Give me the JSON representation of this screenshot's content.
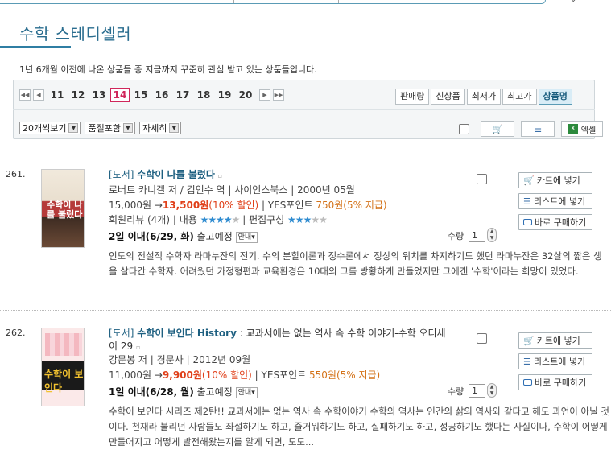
{
  "page": {
    "title": "수학 스테디셀러",
    "description": "1년 6개월 이전에 나온 상품들 중 지금까지 꾸준히 관심 받고 있는 상품들입니다."
  },
  "pagination": {
    "pages": [
      "11",
      "12",
      "13",
      "14",
      "15",
      "16",
      "17",
      "18",
      "19",
      "20"
    ],
    "current": "14",
    "first_icon": "first-page-icon",
    "prev_icon": "prev-page-icon",
    "next_icon": "next-page-icon",
    "last_icon": "last-page-icon"
  },
  "sort": {
    "tabs": [
      "판매량",
      "신상품",
      "최저가",
      "최고가",
      "상품명"
    ],
    "active": "상품명"
  },
  "filters": {
    "per_page": "20개씩보기",
    "stock": "품절포함",
    "view": "자세히"
  },
  "toolbar": {
    "excel_label": "엑셀",
    "cart_icon": "cart-icon",
    "list_icon": "list-icon",
    "excel_icon": "excel-icon"
  },
  "actions": {
    "cart": "카트에 넣기",
    "wishlist": "리스트에 넣기",
    "buy_now": "바로 구매하기"
  },
  "labels": {
    "quantity": "수량",
    "guide": "안내",
    "arrow": "→"
  },
  "items": [
    {
      "index": "261.",
      "category": "[도서]",
      "title": "수학이 나를 불렀다",
      "subtitle": "",
      "subtitle_cont": "",
      "meta": "로버트 카니겔 저 / 김인수 역 | 사이언스북스 | 2000년 05월",
      "list_price": "15,000원",
      "sale_price": "13,500원",
      "discount": "(10% 할인)",
      "points_label": " | YES포인트 ",
      "points": "750원(5% 지급)",
      "review_label": "회원리뷰 (4개)",
      "content_label": " | 내용 ",
      "content_stars": 4,
      "edit_label": " | 편집구성 ",
      "edit_stars": 3,
      "shipping_bold": "2일 이내(6/29, 화)",
      "shipping_text": " 출고예정",
      "quantity": "1",
      "cover_text": "수학이 나를 불렀다",
      "description": "인도의 전설적 수학자 라마누잔의 전기. 수의 분할이론과 정수론에서 정상의 위치를 차지하기도 했던 라마누잔은 32살의 짧은 생을 살다간 수학자. 어려웠던 가정형편과 교육환경은 10대의 그를 방황하게 만들었지만 그에겐 '수학'이라는 희망이 있었다."
    },
    {
      "index": "262.",
      "category": "[도서]",
      "title": "수학이 보인다 History",
      "subtitle": " : 교과서에는 없는 역사 속 수학 이야기-수학 오디세",
      "subtitle_cont": "이 29",
      "meta": "강문봉 저 | 경문사 | 2012년 09월",
      "list_price": "11,000원",
      "sale_price": "9,900원",
      "discount": "(10% 할인)",
      "points_label": " | YES포인트 ",
      "points": "550원(5% 지급)",
      "shipping_bold": "1일 이내(6/28, 월)",
      "shipping_text": " 출고예정",
      "quantity": "1",
      "cover_text": "수학이 보인다",
      "description": "수학이 보인다 시리즈 제2탄!! 교과서에는 없는 역사 속 수학이야기 수학의 역사는 인간의 삶의 역사와 같다고 해도 과언이 아닐 것이다. 천재라 불리던 사람들도 좌절하기도 하고, 즐거워하기도 하고, 실패하기도 하고, 성공하기도 했다는 사실이나, 수학이 어떻게 만들어지고 어떻게 발전해왔는지를 알게 되면, 도도..."
    }
  ]
}
